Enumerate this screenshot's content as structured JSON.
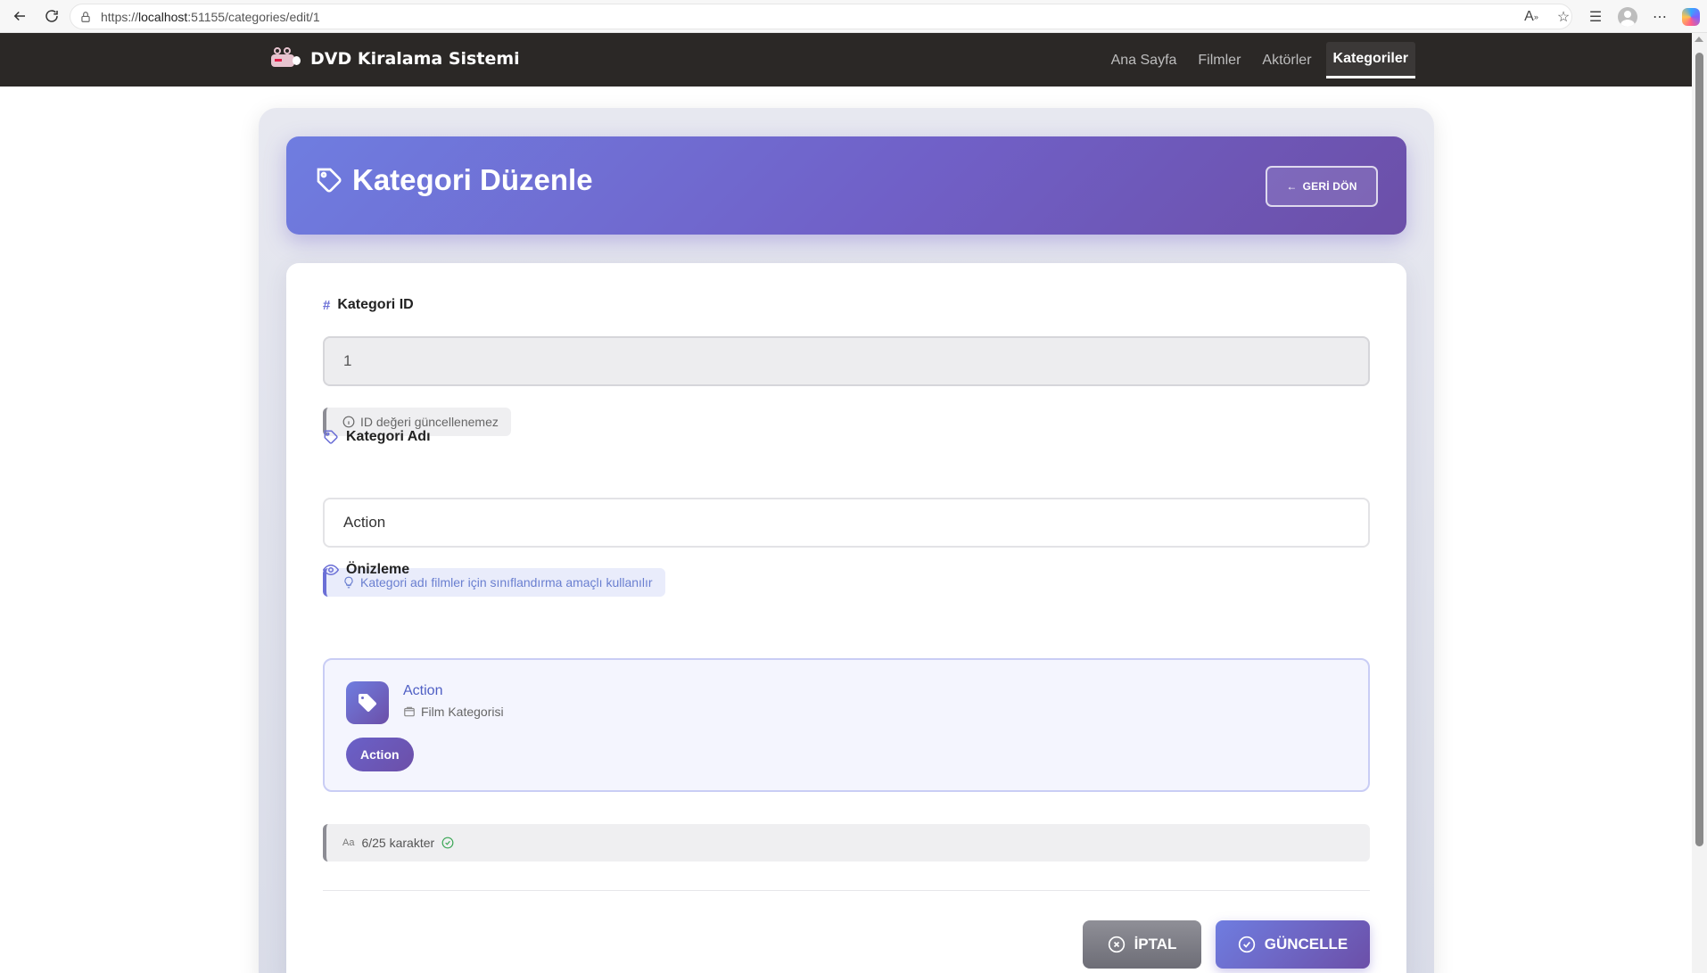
{
  "browser": {
    "url_scheme": "https://",
    "url_host": "localhost",
    "url_rest": ":51155/categories/edit/1"
  },
  "navbar": {
    "brand": "DVD Kiralama Sistemi",
    "links": [
      "Ana Sayfa",
      "Filmler",
      "Aktörler",
      "Kategoriler"
    ],
    "active": "Kategoriler"
  },
  "header": {
    "title": "Kategori Düzenle",
    "back_label": "GERİ DÖN"
  },
  "form": {
    "id_label": "Kategori ID",
    "id_value": "1",
    "id_hint": "ID değeri güncellenemez",
    "name_label": "Kategori Adı",
    "name_value": "Action",
    "name_hint": "Kategori adı filmler için sınıflandırma amaçlı kullanılır",
    "preview_label": "Önizleme",
    "preview_name": "Action",
    "preview_sub": "Film Kategorisi",
    "preview_pill": "Action",
    "counter_prefix": "Aa",
    "counter_text": "6/25 karakter"
  },
  "actions": {
    "cancel_label": "İPTAL",
    "save_label": "GÜNCELLE"
  },
  "colors": {
    "accent": "#6f7de0",
    "accent_dark": "#6c4fa8",
    "navbar": "#2b2826"
  }
}
